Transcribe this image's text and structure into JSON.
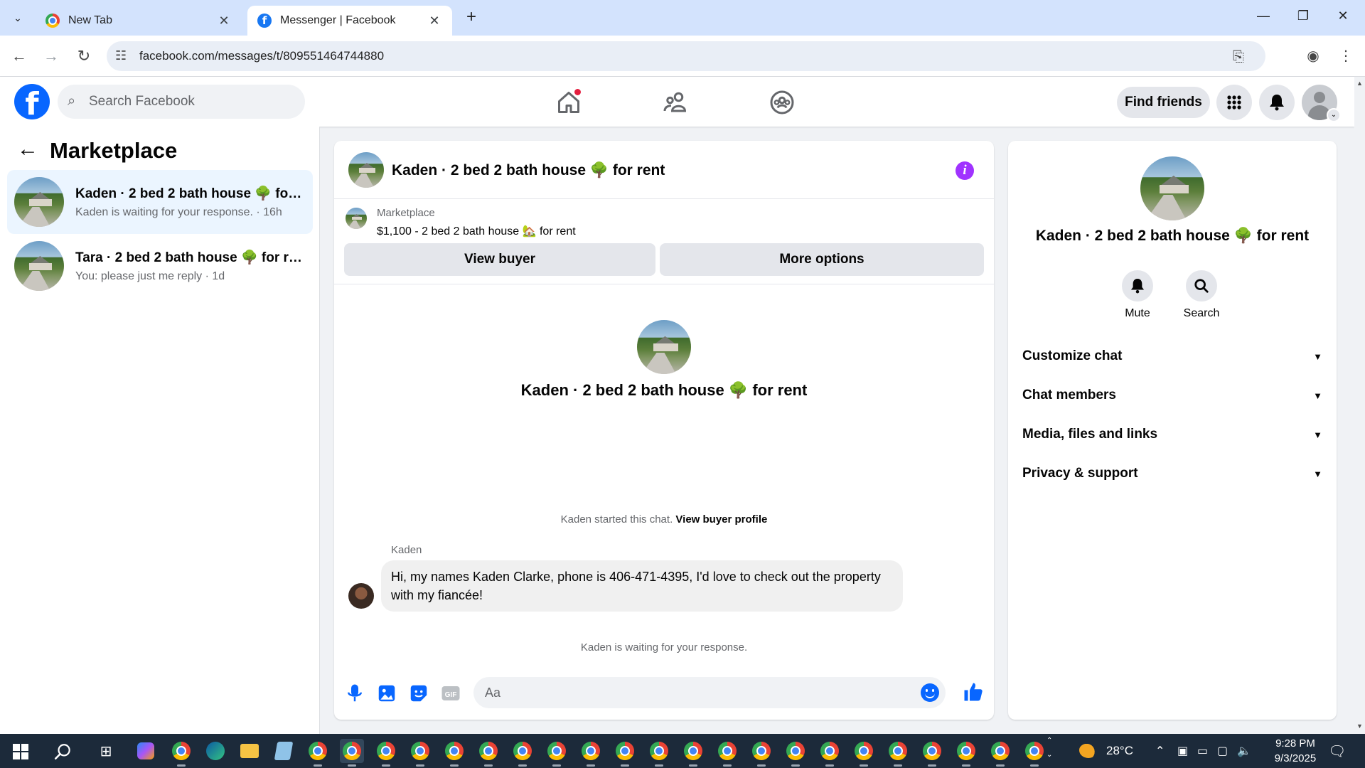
{
  "browser": {
    "tabs": [
      {
        "title": "New Tab",
        "favicon": "chrome-icon"
      },
      {
        "title": "Messenger | Facebook",
        "favicon": "facebook-icon"
      }
    ],
    "url": "facebook.com/messages/t/809551464744880"
  },
  "fb_header": {
    "search_placeholder": "Search Facebook",
    "find_friends": "Find friends"
  },
  "sidebar": {
    "title": "Marketplace",
    "conversations": [
      {
        "name": "Kaden · 2 bed 2 bath house 🌳 for rent",
        "preview": "Kaden is waiting for your response. · 16h",
        "active": true
      },
      {
        "name": "Tara · 2 bed 2 bath house 🌳 for rent",
        "preview": "You: please just me reply · 1d",
        "active": false
      }
    ]
  },
  "chat": {
    "title": "Kaden · 2 bed 2 bath house 🌳 for rent",
    "listing_source": "Marketplace",
    "listing_desc": "$1,100 - 2 bed 2 bath house 🏡 for rent",
    "view_buyer": "View buyer",
    "more_options": "More options",
    "intro_title": "Kaden · 2 bed 2 bath house 🌳 for rent",
    "started_text": "Kaden started this chat.",
    "started_link": "View buyer profile",
    "sender": "Kaden",
    "message": "Hi, my names Kaden Clarke, phone is 406-471-4395, I'd love to check out the property with my fiancée!",
    "waiting": "Kaden is waiting for your response.",
    "composer_placeholder": "Aa",
    "accent": "#0866ff"
  },
  "right_panel": {
    "title": "Kaden · 2 bed 2 bath house 🌳 for rent",
    "actions": [
      {
        "label": "Mute",
        "icon": "bell-icon"
      },
      {
        "label": "Search",
        "icon": "search-icon"
      }
    ],
    "sections": [
      "Customize chat",
      "Chat members",
      "Media, files and links",
      "Privacy & support"
    ]
  },
  "taskbar": {
    "weather": "28°C",
    "time": "9:28 PM",
    "date": "9/3/2025"
  }
}
